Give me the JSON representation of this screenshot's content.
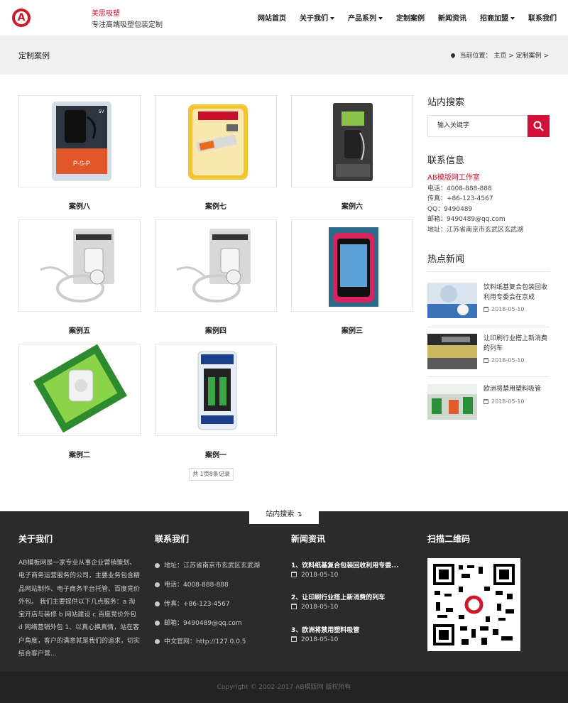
{
  "header": {
    "logo_letter": "A",
    "brand_name": "美思吸塑",
    "slogan": "专注高端吸塑包装定制",
    "nav": [
      {
        "label": "网站首页",
        "dropdown": false
      },
      {
        "label": "关于我们",
        "dropdown": true
      },
      {
        "label": "产品系列",
        "dropdown": true
      },
      {
        "label": "定制案例",
        "dropdown": false
      },
      {
        "label": "新闻资讯",
        "dropdown": false
      },
      {
        "label": "招商加盟",
        "dropdown": true
      },
      {
        "label": "联系我们",
        "dropdown": false
      }
    ]
  },
  "banner": {
    "title": "定制案例",
    "breadcrumb": "当前位置： 主页 > 定制案例 >"
  },
  "products": [
    {
      "title": "案例八",
      "image": "adapter-blister-pack"
    },
    {
      "title": "案例七",
      "image": "usb-drive-blister-pack"
    },
    {
      "title": "案例六",
      "image": "car-charger-blister-pack"
    },
    {
      "title": "案例五",
      "image": "usb-car-charger-cable-pack"
    },
    {
      "title": "案例四",
      "image": "usb-car-charger-cable-pack"
    },
    {
      "title": "案例三",
      "image": "phone-case-blister-pack"
    },
    {
      "title": "案例二",
      "image": "wall-plug-blister-pack"
    },
    {
      "title": "案例一",
      "image": "battery-charger-blister-pack"
    }
  ],
  "pager": "共 1页8条记录",
  "sidebar": {
    "search_title": "站内搜索",
    "search_placeholder": "输入关键字",
    "contact_title": "联系信息",
    "contact": {
      "studio": "AB模版网工作室",
      "phone": "电话：4008-888-888",
      "fax": "传真：+86-123-4567",
      "qq": "QQ：9490489",
      "email": "邮箱：9490489@qq.com",
      "address": "地址：江苏省南京市玄武区玄武湖"
    },
    "news_title": "热点新闻",
    "news": [
      {
        "title": "饮料纸基复合包装回收利用专委会在京成",
        "date": "2018-05-10"
      },
      {
        "title": "让印刷行业搭上新消费的列车",
        "date": "2018-05-10"
      },
      {
        "title": "欧洲将禁用塑料吸管",
        "date": "2018-05-10"
      }
    ]
  },
  "footer": {
    "search_tab": "站内搜索 ↴",
    "about_title": "关于我们",
    "about_text": "AB模板网是一家专业从事企业营销策划、电子商务运营服务的公司，主要业务包含精品网站制作、电子商务平台托管、百度竞价外包。 我们主要提供以下几点服务：a 淘宝开店与装修 b 网站建设 c 百度竞价外包 d 网络营销外包 1、以真心换真情，站在客户角度，客户的满意就是我们的追求，切实结合客户营...",
    "contact_title": "联系我们",
    "contact": [
      "地址：江苏省南京市玄武区玄武湖",
      "电话：4008-888-888",
      "传真：+86-123-4567",
      "邮箱：9490489@qq.com",
      "中文官网：http://127.0.0.5"
    ],
    "news_title": "新闻资讯",
    "news": [
      {
        "title": "1、饮料纸基复合包装回收利用专委...",
        "date": "2018-05-10"
      },
      {
        "title": "2、让印刷行业搭上新消费的列车",
        "date": "2018-05-10"
      },
      {
        "title": "3、欧洲将禁用塑料吸管",
        "date": "2018-05-10"
      }
    ],
    "qr_title": "扫描二维码",
    "copyright": "Copyright © 2002-2017 AB模版网 版权所有"
  },
  "colors": {
    "accent": "#c8102e",
    "search_button": "#d3103a",
    "footer_bg": "#2b2b2b"
  }
}
